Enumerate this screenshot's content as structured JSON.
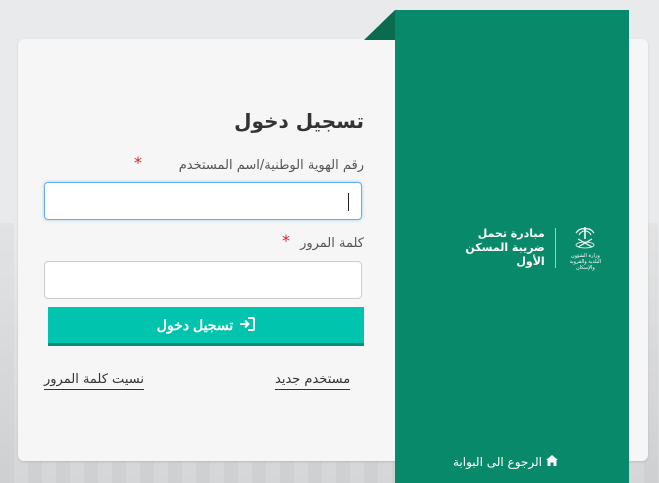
{
  "login": {
    "title": "تسجيل دخول",
    "id_label": "رقم الهوية الوطنية/اسم المستخدم",
    "required_mark": "*",
    "password_label": "كلمة المرور",
    "id_value": "",
    "password_value": "",
    "submit_label": "تسجيل دخول",
    "new_user_link": "مستخدم جديد",
    "forgot_password_link": "نسيت كلمة المرور"
  },
  "side_panel": {
    "initiative_line1": "مبادرة تحمل",
    "initiative_line2": "ضريبة المسكن الأول",
    "ministry_logo_text": "وزارة الشؤون البلدية والقروية والإسكان",
    "back_link": "الرجوع الى البوابة",
    "color": "#088a6a"
  },
  "icons": {
    "login": "sign-in-icon",
    "home": "home-icon",
    "ministry": "ministry-logo-icon"
  },
  "colors": {
    "accent": "#00c4ae",
    "required": "#d9232d"
  }
}
